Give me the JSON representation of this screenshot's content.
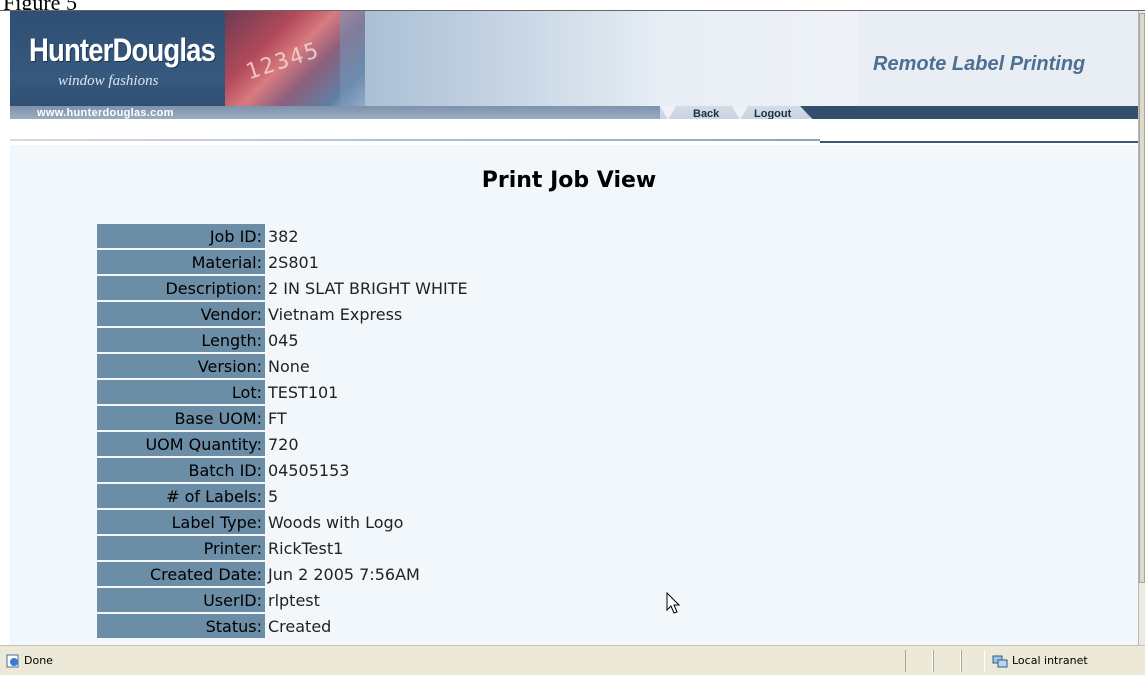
{
  "figure_caption": "Figure 5",
  "banner": {
    "logo_main": "HunterDouglas",
    "logo_sub": "window fashions",
    "photo_number": "12345",
    "url": "www.hunterdouglas.com",
    "app_title": "Remote Label Printing"
  },
  "nav": {
    "back_label": "Back",
    "logout_label": "Logout"
  },
  "page": {
    "heading": "Print Job View"
  },
  "job": {
    "rows": [
      {
        "label": "Job ID:",
        "value": "382"
      },
      {
        "label": "Material:",
        "value": "2S801"
      },
      {
        "label": "Description:",
        "value": "2 IN SLAT BRIGHT WHITE"
      },
      {
        "label": "Vendor:",
        "value": "Vietnam Express"
      },
      {
        "label": "Length:",
        "value": "045"
      },
      {
        "label": "Version:",
        "value": "None"
      },
      {
        "label": "Lot:",
        "value": "TEST101"
      },
      {
        "label": "Base UOM:",
        "value": "FT"
      },
      {
        "label": "UOM Quantity:",
        "value": "720"
      },
      {
        "label": "Batch ID:",
        "value": "04505153"
      },
      {
        "label": "# of Labels:",
        "value": "5"
      },
      {
        "label": "Label Type:",
        "value": "Woods with Logo"
      },
      {
        "label": "Printer:",
        "value": "RickTest1"
      },
      {
        "label": "Created Date:",
        "value": "Jun 2 2005 7:56AM"
      },
      {
        "label": "UserID:",
        "value": "rlptest"
      },
      {
        "label": "Status:",
        "value": "Created"
      }
    ]
  },
  "statusbar": {
    "status": "Done",
    "zone": "Local intranet",
    "icon": "ie-page-icon",
    "zone_icon": "intranet-icon"
  },
  "colors": {
    "label_cell": "#6b8ea6",
    "content_bg": "#f2f7fc",
    "banner_dark": "#344f6e",
    "app_title": "#4d6f94"
  }
}
